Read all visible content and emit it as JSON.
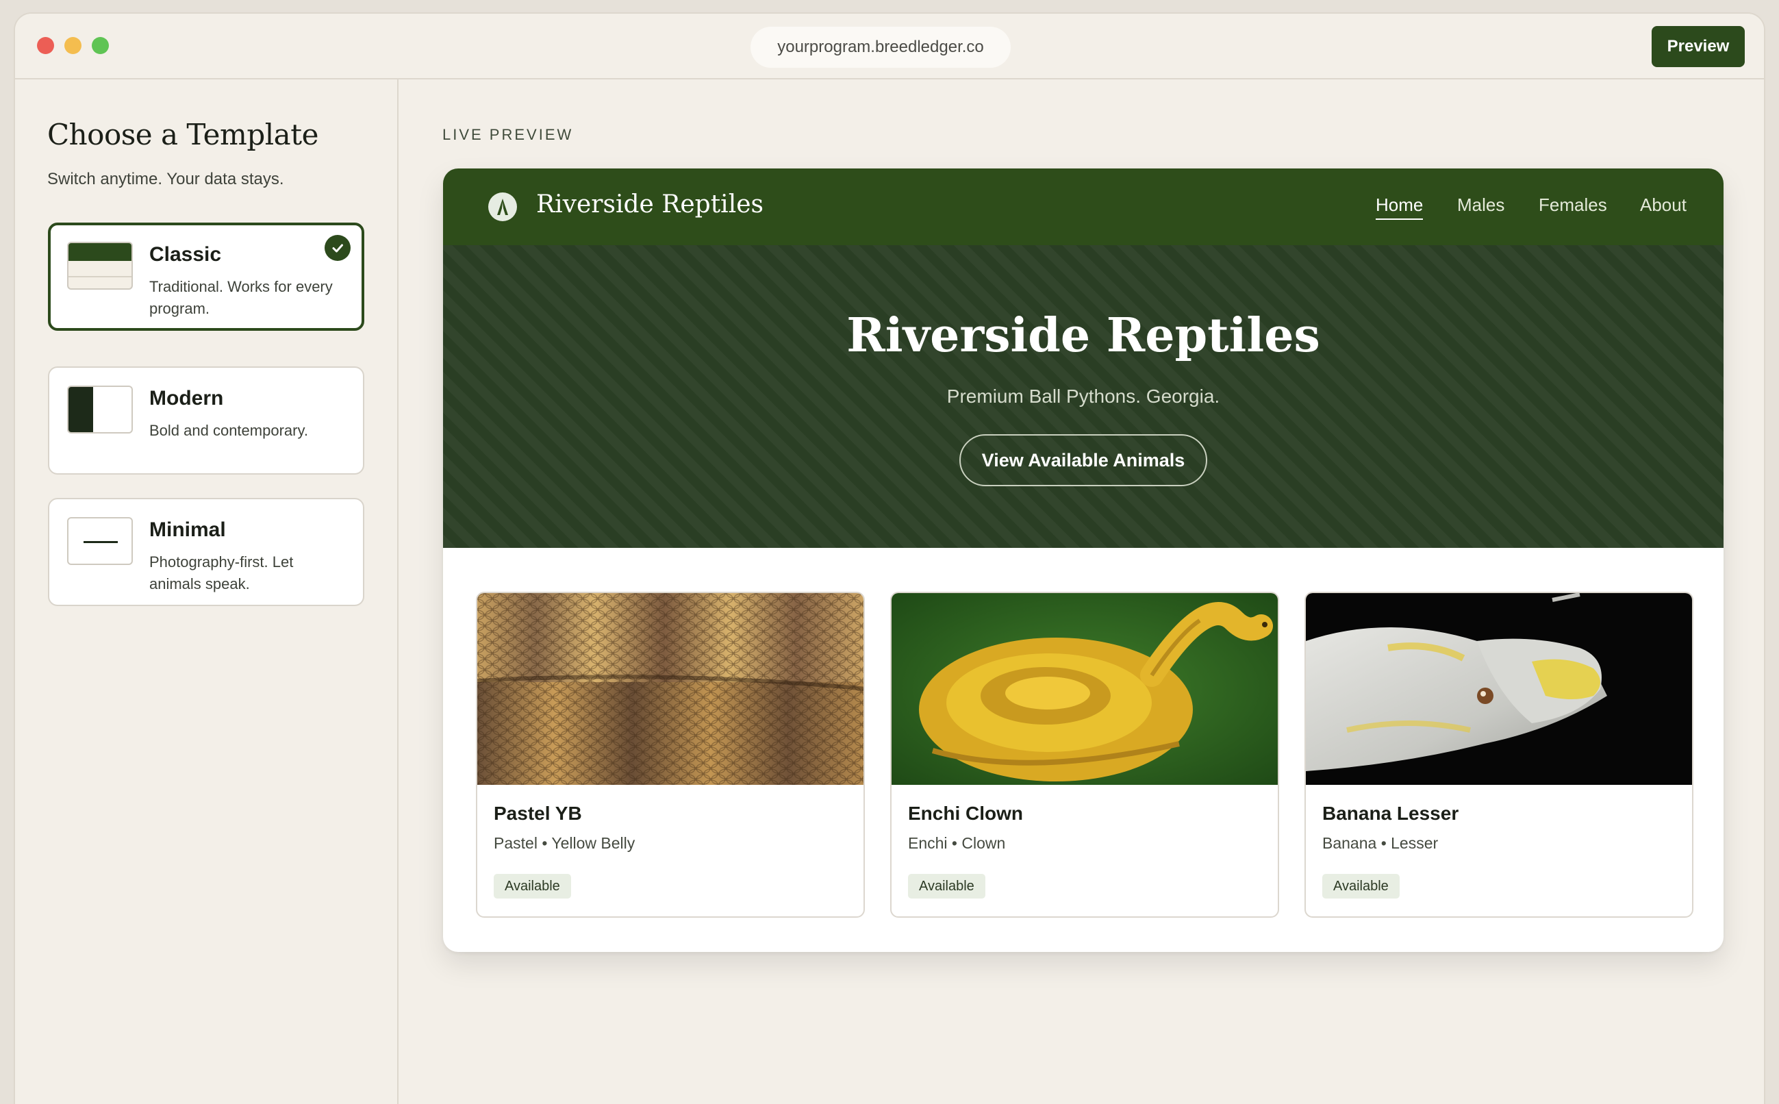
{
  "browser": {
    "url": "yourprogram.breedledger.co",
    "preview_label": "Preview"
  },
  "sidebar": {
    "title": "Choose a Template",
    "subtitle": "Switch anytime. Your data stays.",
    "templates": [
      {
        "name": "Classic",
        "description": "Traditional. Works for every program.",
        "selected": true
      },
      {
        "name": "Modern",
        "description": "Bold and contemporary.",
        "selected": false
      },
      {
        "name": "Minimal",
        "description": "Photography-first. Let animals speak.",
        "selected": false
      }
    ]
  },
  "main": {
    "live_preview_label": "LIVE PREVIEW"
  },
  "site": {
    "name": "Riverside Reptiles",
    "nav": [
      {
        "label": "Home",
        "active": true
      },
      {
        "label": "Males",
        "active": false
      },
      {
        "label": "Females",
        "active": false
      },
      {
        "label": "About",
        "active": false
      }
    ],
    "hero": {
      "title": "Riverside Reptiles",
      "subtitle": "Premium Ball Pythons. Georgia.",
      "cta": "View Available Animals"
    },
    "animals": [
      {
        "name": "Pastel YB",
        "genes": "Pastel • Yellow Belly",
        "status": "Available"
      },
      {
        "name": "Enchi Clown",
        "genes": "Enchi • Clown",
        "status": "Available"
      },
      {
        "name": "Banana Lesser",
        "genes": "Banana • Lesser",
        "status": "Available"
      }
    ]
  },
  "colors": {
    "brand_green": "#2c4a1c",
    "hero_bg": "#2a3e24",
    "page_bg": "#f3efe8"
  }
}
